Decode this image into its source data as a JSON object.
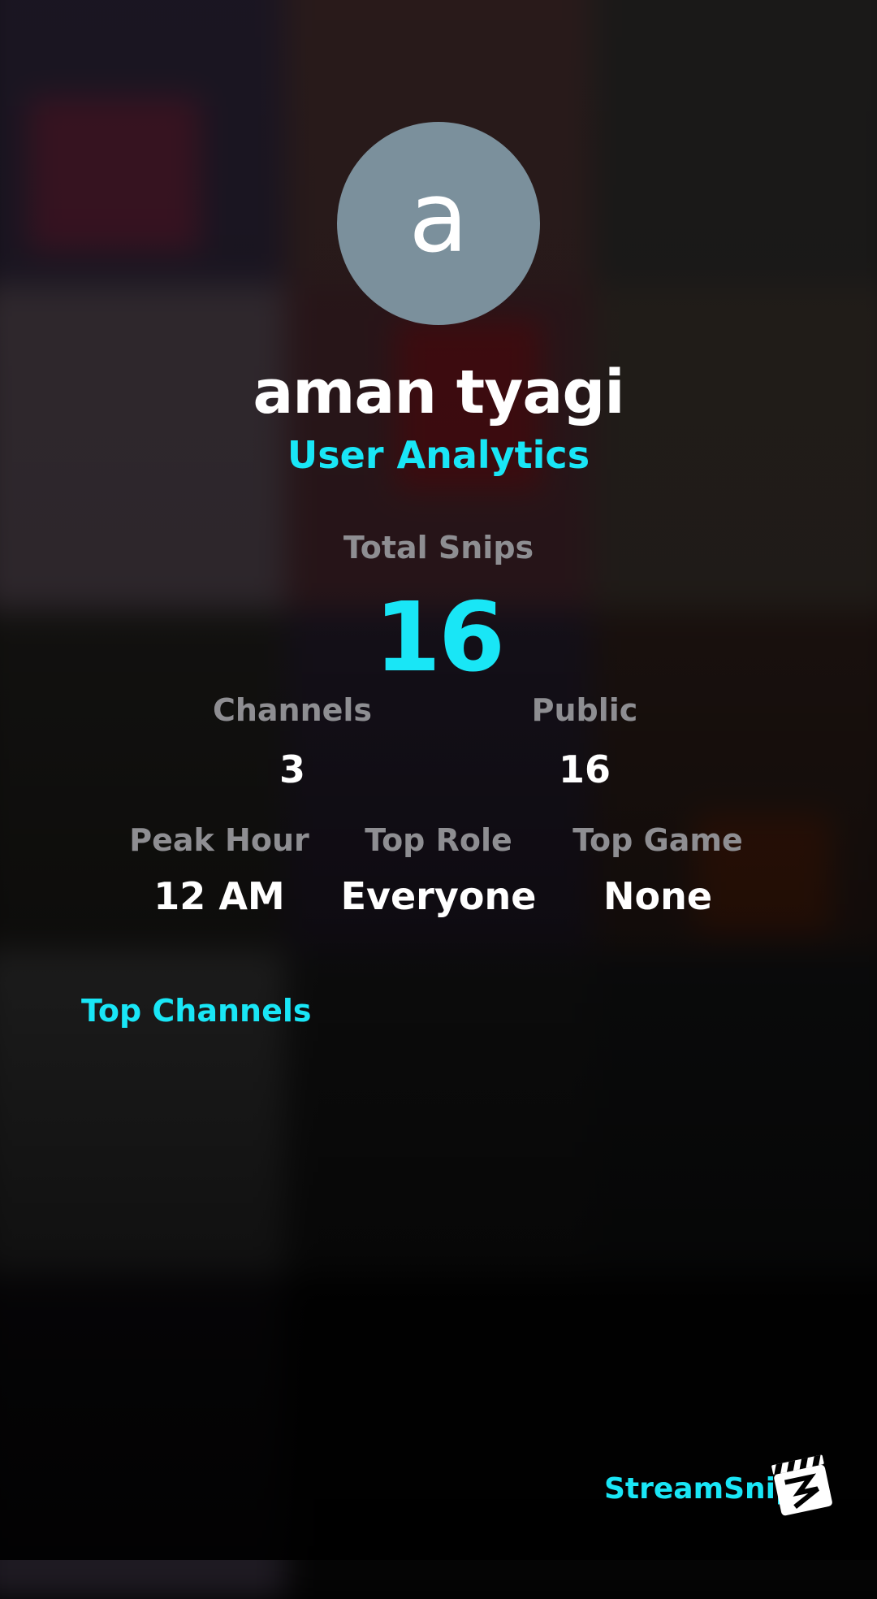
{
  "profile": {
    "avatar_letter": "a",
    "avatar_color": "#7b909c",
    "username": "aman tyagi",
    "subtitle": "User Analytics"
  },
  "stats": {
    "total_snips": {
      "label": "Total Snips",
      "value": "16"
    },
    "channels": {
      "label": "Channels",
      "value": "3"
    },
    "public": {
      "label": "Public",
      "value": "16"
    },
    "peak_hour": {
      "label": "Peak Hour",
      "value": "12 AM"
    },
    "top_role": {
      "label": "Top Role",
      "value": "Everyone"
    },
    "top_game": {
      "label": "Top Game",
      "value": "None"
    }
  },
  "top_channels": {
    "title": "Top Channels"
  },
  "branding": {
    "name": "StreamSnip",
    "logo_icon": "clapperboard-icon"
  },
  "colors": {
    "accent": "#19e6f6",
    "label_gray": "#8e8e92",
    "background": "#000000"
  }
}
